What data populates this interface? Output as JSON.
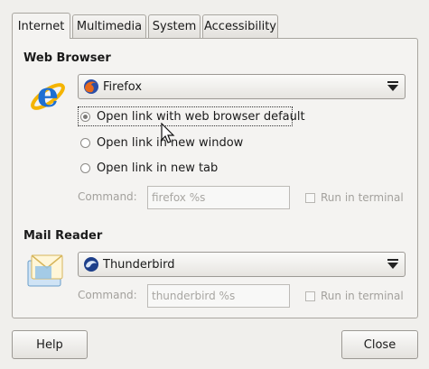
{
  "tabs": [
    "Internet",
    "Multimedia",
    "System",
    "Accessibility"
  ],
  "web": {
    "title": "Web Browser",
    "browser": "Firefox",
    "options": [
      "Open link with web browser default",
      "Open link in new window",
      "Open link in new tab"
    ],
    "command_label": "Command:",
    "command_value": "firefox %s",
    "run_label": "Run in terminal"
  },
  "mail": {
    "title": "Mail Reader",
    "client": "Thunderbird",
    "command_label": "Command:",
    "command_value": "thunderbird %s",
    "run_label": "Run in terminal"
  },
  "buttons": {
    "help": "Help",
    "close": "Close"
  },
  "icons": {
    "browser_logo": "internet-explorer-icon",
    "firefox": "firefox-icon",
    "mail_logo": "mail-envelope-icon",
    "thunderbird": "thunderbird-icon",
    "dropdown": "triangle-down-icon",
    "cursor": "mouse-pointer-icon"
  }
}
